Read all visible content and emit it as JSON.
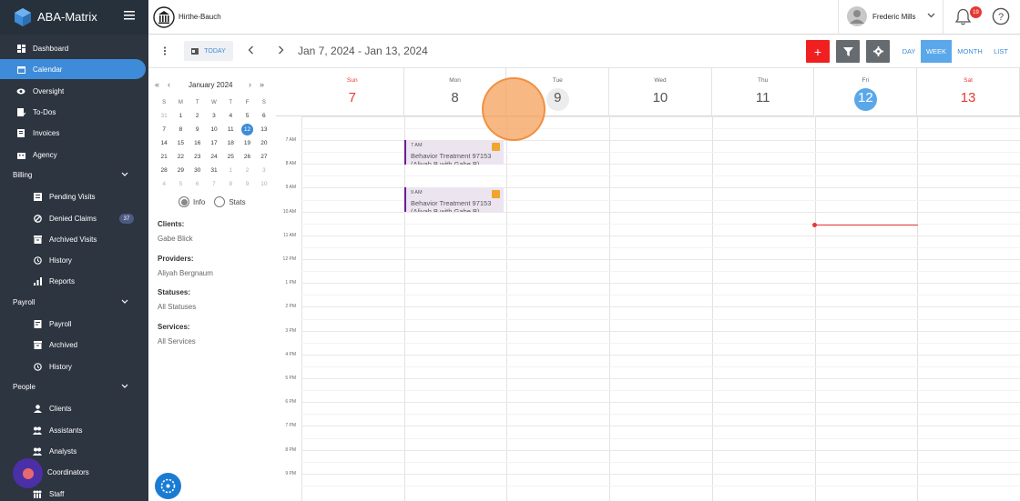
{
  "app": {
    "brand": "ABA-Matrix"
  },
  "header": {
    "company": "Hirthe-Bauch",
    "user_name": "Frederic Mills",
    "notification_count": "19"
  },
  "sidebar": {
    "items": [
      {
        "label": "Dashboard"
      },
      {
        "label": "Calendar"
      },
      {
        "label": "Oversight"
      },
      {
        "label": "To-Dos"
      },
      {
        "label": "Invoices"
      },
      {
        "label": "Agency"
      }
    ],
    "billing": {
      "label": "Billing",
      "items": [
        {
          "label": "Pending Visits"
        },
        {
          "label": "Denied Claims",
          "badge": "37"
        },
        {
          "label": "Archived Visits"
        },
        {
          "label": "History"
        },
        {
          "label": "Reports"
        }
      ]
    },
    "payroll": {
      "label": "Payroll",
      "items": [
        {
          "label": "Payroll"
        },
        {
          "label": "Archived"
        },
        {
          "label": "History"
        }
      ]
    },
    "people": {
      "label": "People",
      "items": [
        {
          "label": "Clients"
        },
        {
          "label": "Assistants"
        },
        {
          "label": "Analysts"
        },
        {
          "label": "Coordinators"
        },
        {
          "label": "Staff"
        }
      ]
    }
  },
  "toolbar": {
    "today_label": "TODAY",
    "date_range": "Jan 7, 2024 - Jan 13, 2024",
    "add_label": "+",
    "views": [
      {
        "label": "DAY",
        "active": false
      },
      {
        "label": "WEEK",
        "active": true
      },
      {
        "label": "MONTH",
        "active": false
      },
      {
        "label": "LIST",
        "active": false
      }
    ]
  },
  "mini_calendar": {
    "title": "January 2024",
    "dow": [
      "S",
      "M",
      "T",
      "W",
      "T",
      "F",
      "S"
    ],
    "weeks": [
      [
        "31",
        "1",
        "2",
        "3",
        "4",
        "5",
        "6"
      ],
      [
        "7",
        "8",
        "9",
        "10",
        "11",
        "12",
        "13"
      ],
      [
        "14",
        "15",
        "16",
        "17",
        "18",
        "19",
        "20"
      ],
      [
        "21",
        "22",
        "23",
        "24",
        "25",
        "26",
        "27"
      ],
      [
        "28",
        "29",
        "30",
        "31",
        "1",
        "2",
        "3"
      ],
      [
        "4",
        "5",
        "6",
        "7",
        "8",
        "9",
        "10"
      ]
    ],
    "today": "12"
  },
  "view_mode": {
    "info": "Info",
    "stats": "Stats",
    "selected": "Info"
  },
  "filters": {
    "clients_label": "Clients:",
    "clients_value": "Gabe Blick",
    "providers_label": "Providers:",
    "providers_value": "Aliyah Bergnaum",
    "statuses_label": "Statuses:",
    "statuses_value": "All Statuses",
    "services_label": "Services:",
    "services_value": "All Services"
  },
  "week": {
    "days": [
      {
        "name": "Sun",
        "num": "7",
        "weekend": true
      },
      {
        "name": "Mon",
        "num": "8"
      },
      {
        "name": "Tue",
        "num": "9",
        "hover": true
      },
      {
        "name": "Wed",
        "num": "10"
      },
      {
        "name": "Thu",
        "num": "11"
      },
      {
        "name": "Fri",
        "num": "12",
        "today": true
      },
      {
        "name": "Sat",
        "num": "13",
        "weekend": true
      }
    ],
    "hours": [
      "7 AM",
      "8 AM",
      "9 AM",
      "10 AM",
      "11 AM",
      "12 PM",
      "1 PM",
      "2 PM",
      "3 PM",
      "4 PM",
      "5 PM",
      "6 PM",
      "7 PM",
      "8 PM",
      "9 PM"
    ]
  },
  "events": [
    {
      "time": "7 AM",
      "title": "Behavior Treatment 97153",
      "subtitle": "(Aliyah B with Gabe B)"
    },
    {
      "time": "9 AM",
      "title": "Behavior Treatment 97153",
      "subtitle": "(Aliyah B with Gabe B)"
    }
  ],
  "colors": {
    "accent": "#3d8bd9",
    "sidebar": "#2c3540",
    "add": "#f02020",
    "weekend": "#e53935",
    "event_border": "#6a1b9a"
  }
}
